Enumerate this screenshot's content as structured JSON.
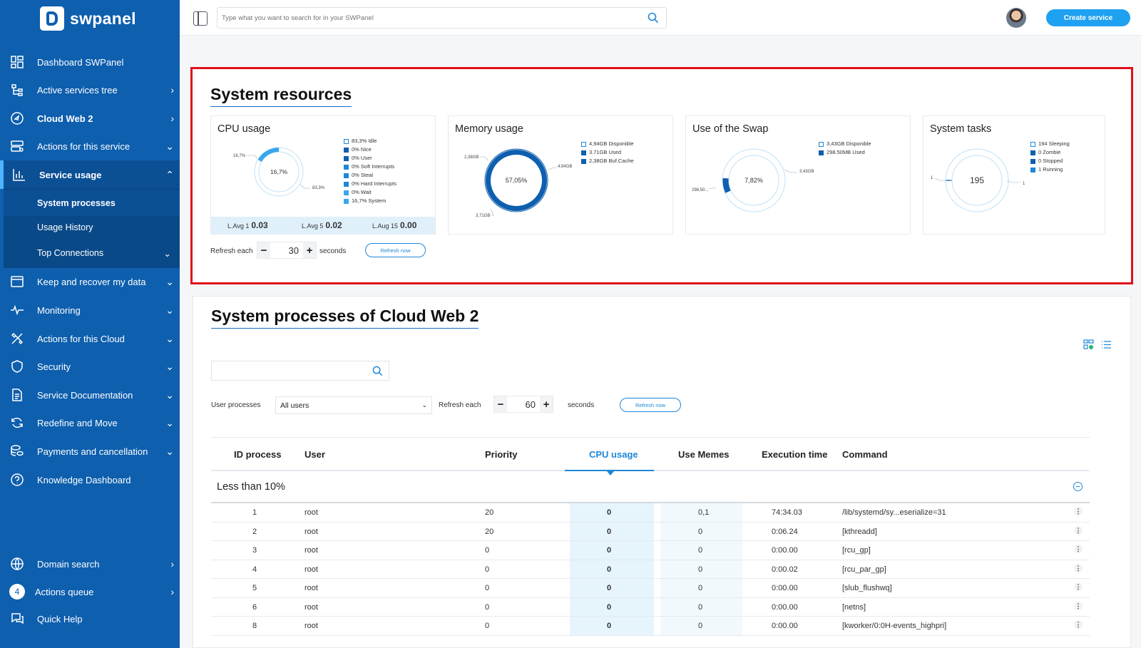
{
  "sidebar": {
    "brand": "swpanel",
    "items": [
      {
        "label": "Dashboard SWPanel",
        "icon": "dashboard-grid-icon",
        "chev": ""
      },
      {
        "label": "Active services tree",
        "icon": "services-tree-icon",
        "chev": "›"
      },
      {
        "label": "Cloud Web 2",
        "icon": "cloud-web-icon",
        "chev": "›"
      },
      {
        "label": "Actions for this service",
        "icon": "server-actions-icon",
        "chev": "⌄"
      },
      {
        "label": "Service usage",
        "icon": "bar-chart-icon",
        "chev": "⌃"
      },
      {
        "label": "Keep and recover my data",
        "icon": "archive-icon",
        "chev": "⌄"
      },
      {
        "label": "Monitoring",
        "icon": "pulse-icon",
        "chev": "⌄"
      },
      {
        "label": "Actions for this Cloud",
        "icon": "tools-icon",
        "chev": "⌄"
      },
      {
        "label": "Security",
        "icon": "shield-icon",
        "chev": "⌄"
      },
      {
        "label": "Service Documentation",
        "icon": "document-icon",
        "chev": "⌄"
      },
      {
        "label": "Redefine and Move",
        "icon": "refresh-move-icon",
        "chev": "⌄"
      },
      {
        "label": "Payments and cancellation",
        "icon": "coins-icon",
        "chev": "⌄"
      },
      {
        "label": "Knowledge Dashboard",
        "icon": "help-circle-icon",
        "chev": ""
      }
    ],
    "subitems": [
      {
        "label": "System processes"
      },
      {
        "label": "Usage History"
      },
      {
        "label": "Top Connections",
        "chev": "⌄"
      }
    ],
    "bottom": [
      {
        "label": "Domain search",
        "icon": "globe-icon",
        "chev": "›"
      },
      {
        "label": "Actions queue",
        "badge": "4",
        "chev": "›"
      },
      {
        "label": "Quick Help",
        "icon": "chat-help-icon",
        "chev": ""
      }
    ]
  },
  "topbar": {
    "search_placeholder": "Type what you want to search for in your SWPanel",
    "create_label": "Create service"
  },
  "resources": {
    "title": "System resources",
    "cpu": {
      "title": "CPU usage",
      "center": "16,7%",
      "label_left": "16,7%",
      "label_right": "83,3%",
      "legend": [
        "83,3% Idle",
        "0% Nice",
        "0% User",
        "0% Soft Interrupts",
        "0% Steal",
        "0% Hard Interrupts",
        "0% Wait",
        "16,7% System"
      ],
      "loads": [
        {
          "label": "L.Avg 1",
          "value": "0.03"
        },
        {
          "label": "L.Avg 5",
          "value": "0.02"
        },
        {
          "label": "L.Aug 15",
          "value": "0.00"
        }
      ]
    },
    "memory": {
      "title": "Memory usage",
      "center": "57,05%",
      "labels": [
        "2,38GB",
        "4,94GB",
        "3,71GB"
      ],
      "legend": [
        "4,94GB Disponible",
        "3.71GB Used",
        "2,38GB Buf.Cache"
      ]
    },
    "swap": {
      "title": "Use of the Swap",
      "center": "7,82%",
      "labels": [
        "3,43GB",
        "298,50..."
      ],
      "legend": [
        "3,43GB Disponible",
        "298.50MB Used"
      ]
    },
    "tasks": {
      "title": "System tasks",
      "center": "195",
      "labels": [
        "1",
        "1"
      ],
      "legend": [
        "194 Sleeping",
        "0 Zombie",
        "0 Stopped",
        "1 Running"
      ]
    },
    "refresh_label": "Refresh each",
    "refresh_value": "30",
    "seconds_label": "seconds",
    "refresh_now": "Refresh now"
  },
  "processes": {
    "title": "System processes of Cloud Web 2",
    "user_label": "User processes",
    "user_select": "All users",
    "refresh_label": "Refresh each",
    "refresh_value": "60",
    "seconds_label": "seconds",
    "refresh_now": "Refresh now",
    "headers": [
      "ID process",
      "User",
      "Priority",
      "CPU usage",
      "Use Memes",
      "Execution time",
      "Command"
    ],
    "group": "Less than 10%",
    "rows": [
      {
        "id": "1",
        "user": "root",
        "priority": "20",
        "cpu": "0",
        "mem": "0,1",
        "time": "74:34.03",
        "cmd": "/lib/systemd/sy...eserialize=31"
      },
      {
        "id": "2",
        "user": "root",
        "priority": "20",
        "cpu": "0",
        "mem": "0",
        "time": "0:06.24",
        "cmd": "[kthreadd]"
      },
      {
        "id": "3",
        "user": "root",
        "priority": "0",
        "cpu": "0",
        "mem": "0",
        "time": "0:00.00",
        "cmd": "[rcu_gp]"
      },
      {
        "id": "4",
        "user": "root",
        "priority": "0",
        "cpu": "0",
        "mem": "0",
        "time": "0:00.02",
        "cmd": "[rcu_par_gp]"
      },
      {
        "id": "5",
        "user": "root",
        "priority": "0",
        "cpu": "0",
        "mem": "0",
        "time": "0:00.00",
        "cmd": "[slub_flushwq]"
      },
      {
        "id": "6",
        "user": "root",
        "priority": "0",
        "cpu": "0",
        "mem": "0",
        "time": "0:00.00",
        "cmd": "[netns]"
      },
      {
        "id": "8",
        "user": "root",
        "priority": "0",
        "cpu": "0",
        "mem": "0",
        "time": "0:00.00",
        "cmd": "[kworker/0:0H-events_highpri]"
      }
    ]
  },
  "colors": {
    "sidebar": "#0e5fae",
    "accent": "#1e87d8",
    "highlight": "#e10f1a"
  }
}
